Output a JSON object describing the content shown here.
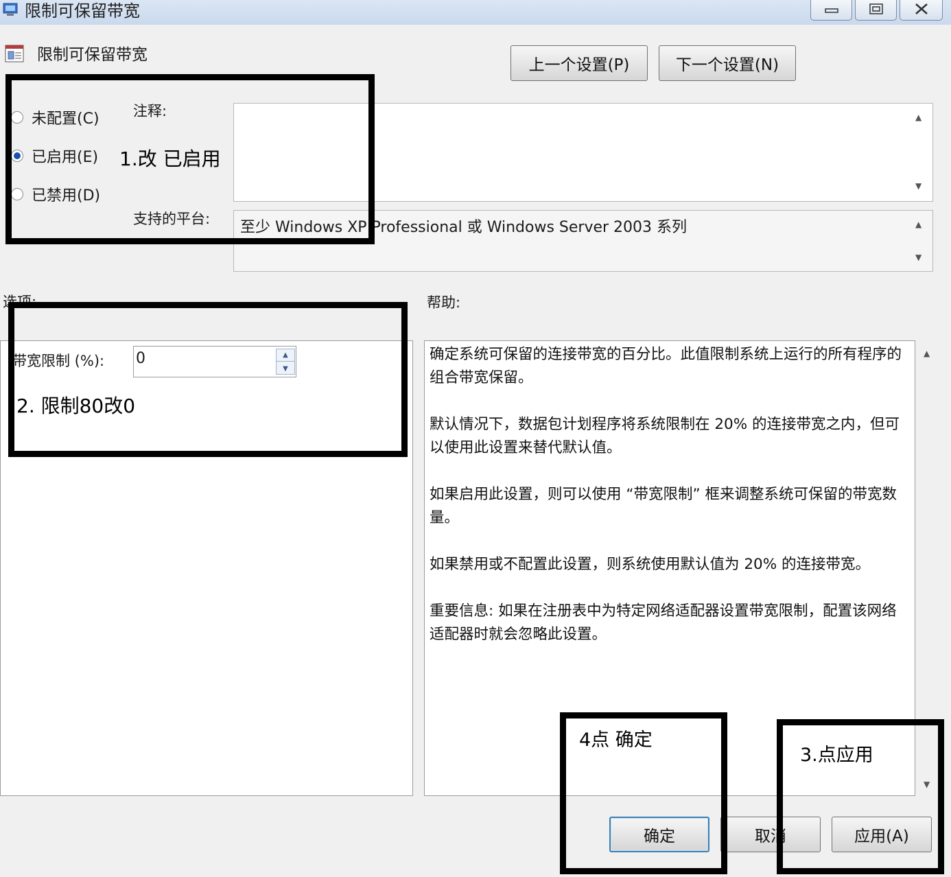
{
  "window": {
    "title": "限制可保留带宽"
  },
  "header": {
    "policy_title": "限制可保留带宽",
    "prev_button": "上一个设置(P)",
    "next_button": "下一个设置(N)"
  },
  "state": {
    "options": [
      {
        "label": "未配置(C)",
        "checked": false
      },
      {
        "label": "已启用(E)",
        "checked": true
      },
      {
        "label": "已禁用(D)",
        "checked": false
      }
    ]
  },
  "comment": {
    "label": "注释:",
    "value": ""
  },
  "platform": {
    "label": "支持的平台:",
    "value": "至少 Windows XP Professional 或 Windows Server 2003 系列"
  },
  "options_section": {
    "label": "选项:",
    "bandwidth_label": "带宽限制 (%):",
    "bandwidth_value": "0"
  },
  "help_section": {
    "label": "帮助:",
    "paragraphs": [
      "确定系统可保留的连接带宽的百分比。此值限制系统上运行的所有程序的组合带宽保留。",
      "默认情况下，数据包计划程序将系统限制在 20% 的连接带宽之内，但可以使用此设置来替代默认值。",
      "如果启用此设置，则可以使用 “带宽限制” 框来调整系统可保留的带宽数量。",
      "如果禁用或不配置此设置，则系统使用默认值为 20% 的连接带宽。",
      "重要信息: 如果在注册表中为特定网络适配器设置带宽限制，配置该网络适配器时就会忽略此设置。"
    ]
  },
  "footer": {
    "ok_button": "确定",
    "cancel_button": "取消",
    "apply_button": "应用(A)"
  },
  "annotations": {
    "step1": "1.改 已启用",
    "step2": "2.  限制80改0",
    "step3": "3.点应用",
    "step4": "4点 确定"
  },
  "colors": {
    "titlebar": "#c9d9ee",
    "selected_radio": "#1a4fb0",
    "annotation": "#000000"
  }
}
